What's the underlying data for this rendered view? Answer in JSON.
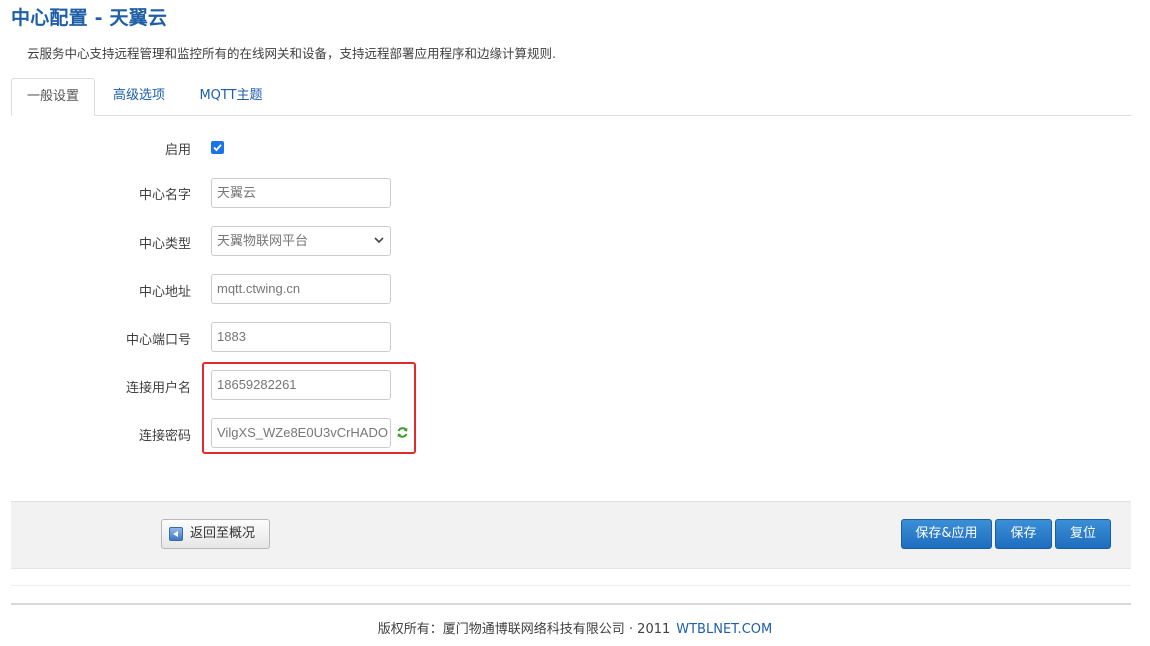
{
  "page": {
    "title": "中心配置 - 天翼云",
    "description": "云服务中心支持远程管理和监控所有的在线网关和设备，支持远程部署应用程序和边缘计算规则."
  },
  "tabs": [
    {
      "label": "一般设置",
      "active": true
    },
    {
      "label": "高级选项",
      "active": false
    },
    {
      "label": "MQTT主题",
      "active": false
    }
  ],
  "form": {
    "enable": {
      "label": "启用",
      "checked": true
    },
    "center_name": {
      "label": "中心名字",
      "value": "天翼云"
    },
    "center_type": {
      "label": "中心类型",
      "value": "天翼物联网平台"
    },
    "center_address": {
      "label": "中心地址",
      "value": "mqtt.ctwing.cn"
    },
    "center_port": {
      "label": "中心端口号",
      "value": "1883"
    },
    "username": {
      "label": "连接用户名",
      "value": "18659282261"
    },
    "password": {
      "label": "连接密码",
      "value": "VilgXS_WZe8E0U3vCrHADO"
    }
  },
  "actions": {
    "back_label": "返回至概况",
    "save_apply_label": "保存&应用",
    "save_label": "保存",
    "reset_label": "复位"
  },
  "footer": {
    "copyright": "版权所有：厦门物通博联网络科技有限公司 · 2011",
    "link_text": "WTBLNET.COM"
  },
  "colors": {
    "accent": "#1e5fa8",
    "button_blue": "#2a7dcc",
    "highlight_red": "#e02b2b",
    "checkbox_blue": "#1a73e8"
  }
}
